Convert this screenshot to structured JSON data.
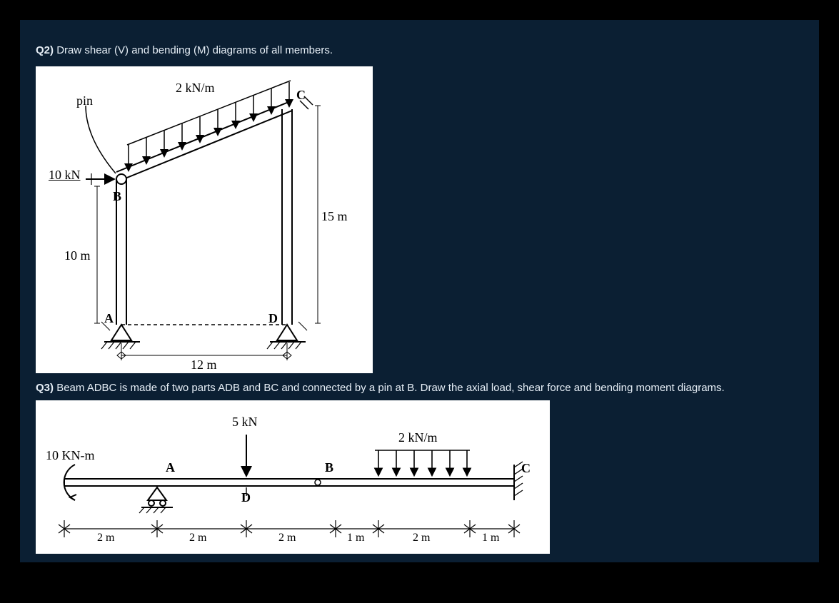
{
  "q2": {
    "tag": "Q2)",
    "text": "Draw shear (V) and bending (M) diagrams of all members.",
    "figure": {
      "pin": "pin",
      "load_dist": "2 kN/m",
      "load_point": "10 kN",
      "height_left": "10 m",
      "height_right": "15 m",
      "span": "12 m",
      "nodes": {
        "A": "A",
        "B": "B",
        "C": "C",
        "D": "D"
      }
    }
  },
  "q3": {
    "tag": "Q3)",
    "text": "Beam ADBC is made of two parts ADB and BC and connected by a pin at B. Draw the axial load, shear force and bending moment diagrams.",
    "figure": {
      "moment": "10 KN-m",
      "load_point": "5 kN",
      "load_dist": "2 kN/m",
      "nodes": {
        "A": "A",
        "B": "B",
        "C": "C",
        "D": "D"
      },
      "dims": [
        "2 m",
        "2 m",
        "2 m",
        "1 m",
        "2 m",
        "1 m"
      ]
    }
  }
}
